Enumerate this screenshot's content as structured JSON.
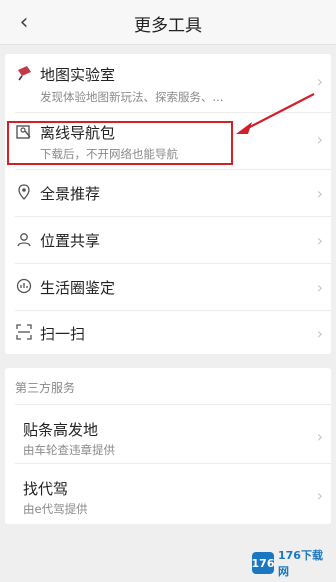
{
  "header": {
    "back_icon": "chevron-left-icon",
    "title": "更多工具"
  },
  "main_list": [
    {
      "icon": "flask-icon",
      "label": "地图实验室",
      "sub": "发现体验地图新玩法、探索服务、..."
    },
    {
      "icon": "offline-download-icon",
      "label": "离线导航包",
      "sub": "下载后，不开网络也能导航"
    },
    {
      "icon": "pin-icon",
      "label": "全景推荐",
      "sub": ""
    },
    {
      "icon": "share-location-icon",
      "label": "位置共享",
      "sub": ""
    },
    {
      "icon": "lifestyle-icon",
      "label": "生活圈鉴定",
      "sub": ""
    },
    {
      "icon": "scan-icon",
      "label": "扫一扫",
      "sub": ""
    }
  ],
  "third_party": {
    "section_title": "第三方服务",
    "items": [
      {
        "label": "贴条高发地",
        "sub": "由车轮查违章提供"
      },
      {
        "label": "找代驾",
        "sub": "由e代驾提供"
      }
    ]
  },
  "watermark": {
    "badge": "176",
    "text": "176下载网"
  },
  "colors": {
    "highlight": "#d31f2a",
    "arrow": "#d31f2a",
    "watermark": "#1a78c2"
  }
}
